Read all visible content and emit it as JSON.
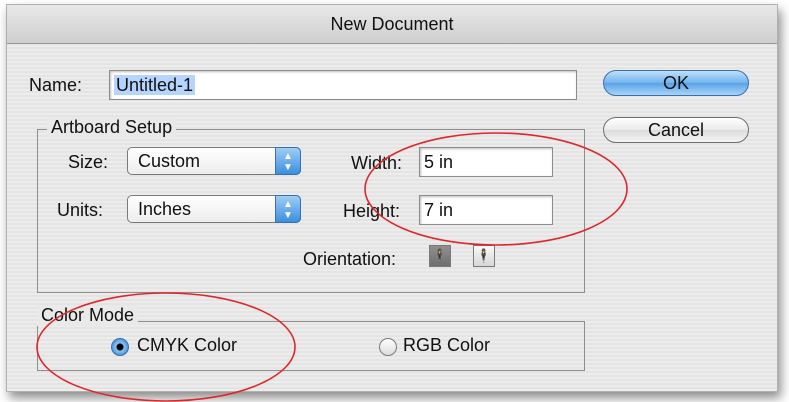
{
  "dialog": {
    "title": "New Document",
    "name_label": "Name:",
    "name_value": "Untitled-1",
    "ok_label": "OK",
    "cancel_label": "Cancel"
  },
  "artboard": {
    "legend": "Artboard Setup",
    "size_label": "Size:",
    "size_value": "Custom",
    "units_label": "Units:",
    "units_value": "Inches",
    "width_label": "Width:",
    "width_value": "5 in",
    "height_label": "Height:",
    "height_value": "7 in",
    "orientation_label": "Orientation:",
    "orientation_selected": "portrait"
  },
  "color_mode": {
    "legend": "Color Mode",
    "cmyk_label": "CMYK Color",
    "rgb_label": "RGB Color",
    "selected": "cmyk"
  },
  "annotations": {
    "circle_color": "#e0262a"
  },
  "icons": [
    "popup-arrows-icon",
    "portrait-orientation-icon",
    "landscape-orientation-icon",
    "radio-selected-icon",
    "radio-unselected-icon"
  ]
}
